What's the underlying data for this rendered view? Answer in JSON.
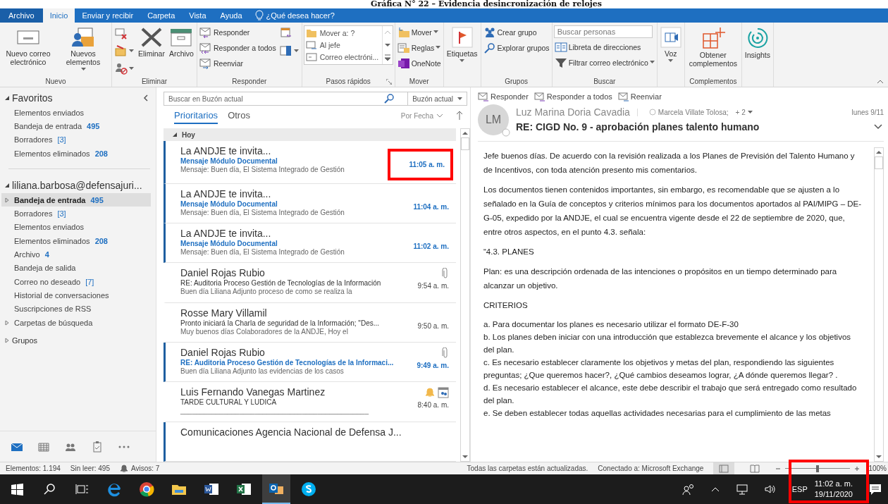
{
  "caption": "Gráfica N° 22 – Evidencia desincronización de relojes",
  "tabs": [
    {
      "label": "Archivo",
      "kind": "file",
      "selected": false
    },
    {
      "label": "Inicio",
      "kind": "tab",
      "selected": true
    },
    {
      "label": "Enviar y recibir",
      "kind": "tab",
      "selected": false
    },
    {
      "label": "Carpeta",
      "kind": "tab",
      "selected": false
    },
    {
      "label": "Vista",
      "kind": "tab",
      "selected": false
    },
    {
      "label": "Ayuda",
      "kind": "tab",
      "selected": false
    },
    {
      "label": "¿Qué desea hacer?",
      "kind": "tell",
      "selected": false
    }
  ],
  "ribbon": {
    "groups": [
      {
        "label": "Nuevo",
        "items": [
          {
            "kind": "large",
            "label": "Nuevo correo electrónico",
            "dropdown": false
          },
          {
            "kind": "large",
            "label": "Nuevos elementos",
            "dropdown": true
          }
        ]
      },
      {
        "label": "Eliminar",
        "items": [
          {
            "kind": "column",
            "items": [
              {
                "kind": "icon",
                "dropdown": false
              },
              {
                "kind": "icon",
                "dropdown": true
              },
              {
                "kind": "icon",
                "dropdown": true
              }
            ]
          },
          {
            "kind": "large",
            "label": "Eliminar",
            "dropdown": false
          },
          {
            "kind": "large",
            "label": "Archivo",
            "dropdown": false
          }
        ]
      },
      {
        "label": "Responder",
        "items": [
          {
            "kind": "column",
            "items": [
              {
                "kind": "small",
                "label": "Responder",
                "dropdown": false
              },
              {
                "kind": "small",
                "label": "Responder a todos",
                "dropdown": false
              },
              {
                "kind": "small",
                "label": "Reenviar",
                "dropdown": false
              }
            ]
          },
          {
            "kind": "column",
            "items": [
              {
                "kind": "icon",
                "dropdown": false
              },
              {
                "kind": "icon",
                "dropdown": true
              }
            ]
          }
        ]
      },
      {
        "label": "Pasos rápidos",
        "launcher": true,
        "items": [
          {
            "kind": "quicksteps",
            "items": [
              "Mover a: ?",
              "Al jefe",
              "Correo electróni..."
            ]
          }
        ]
      },
      {
        "label": "Mover",
        "items": [
          {
            "kind": "column",
            "items": [
              {
                "kind": "small",
                "label": "Mover",
                "dropdown": true
              },
              {
                "kind": "small",
                "label": "Reglas",
                "dropdown": true
              },
              {
                "kind": "small",
                "label": "OneNote",
                "dropdown": false
              }
            ]
          }
        ]
      },
      {
        "items": [
          {
            "kind": "large",
            "label": "Etiquetas",
            "dropdown": true
          }
        ]
      },
      {
        "label": "Grupos",
        "items": [
          {
            "kind": "column",
            "items": [
              {
                "kind": "small",
                "label": "Crear grupo",
                "dropdown": false
              },
              {
                "kind": "small",
                "label": "Explorar grupos",
                "dropdown": false
              }
            ]
          }
        ]
      },
      {
        "label": "Buscar",
        "items": [
          {
            "kind": "column",
            "items": [
              {
                "kind": "field",
                "placeholder": "Buscar personas"
              },
              {
                "kind": "small",
                "label": "Libreta de direcciones",
                "dropdown": false
              },
              {
                "kind": "small",
                "label": "Filtrar correo electrónico",
                "dropdown": true
              }
            ]
          }
        ]
      },
      {
        "items": [
          {
            "kind": "large",
            "label": "Voz",
            "dropdown": true
          }
        ]
      },
      {
        "label": "Complementos",
        "items": [
          {
            "kind": "large",
            "label": "Obtener complementos",
            "dropdown": false
          }
        ]
      },
      {
        "items": [
          {
            "kind": "large",
            "label": "Insights",
            "dropdown": false
          }
        ]
      }
    ]
  },
  "folders": {
    "sections": [
      {
        "label": "Favoritos",
        "kind": "favorites",
        "expanded": true,
        "items": [
          {
            "label": "Elementos enviados",
            "selected": false
          },
          {
            "label": "Bandeja de entrada",
            "count": "495",
            "count_bold": true,
            "selected": false
          },
          {
            "label": "Borradores",
            "count": "[3]",
            "count_bold": false,
            "selected": false
          },
          {
            "label": "Elementos eliminados",
            "count": "208",
            "count_bold": true,
            "selected": false
          }
        ]
      },
      {
        "label": "liliana.barbosa@defensajuri...",
        "kind": "account",
        "expanded": true,
        "items": [
          {
            "label": "Bandeja de entrada",
            "count": "495",
            "count_bold": true,
            "selected": true,
            "expanded": false
          },
          {
            "label": "Borradores",
            "count": "[3]",
            "count_bold": false,
            "selected": false
          },
          {
            "label": "Elementos enviados",
            "selected": false
          },
          {
            "label": "Elementos eliminados",
            "count": "208",
            "count_bold": true,
            "selected": false
          },
          {
            "label": "Archivo",
            "count": "4",
            "count_bold": true,
            "selected": false
          },
          {
            "label": "Bandeja de salida",
            "selected": false
          },
          {
            "label": "Correo no deseado",
            "count": "[7]",
            "count_bold": false,
            "selected": false
          },
          {
            "label": "Historial de conversaciones",
            "selected": false
          },
          {
            "label": "Suscripciones de RSS",
            "selected": false
          },
          {
            "label": "Carpetas de búsqueda",
            "selected": false,
            "expanded": false
          }
        ]
      },
      {
        "label": "Grupos",
        "kind": "groups",
        "expanded": false
      }
    ],
    "nav": [
      {
        "selected": true
      },
      {
        "selected": false
      },
      {
        "selected": false
      },
      {
        "selected": false
      },
      {
        "selected": false
      }
    ]
  },
  "mail_list": {
    "search": {
      "placeholder": "Buscar en Buzón actual",
      "scope": "Buzón actual"
    },
    "tabs": [
      {
        "label": "Prioritarios",
        "selected": true
      },
      {
        "label": "Otros",
        "selected": false
      }
    ],
    "sort": "Por Fecha",
    "group": {
      "label": "Hoy",
      "expanded": true
    },
    "messages": [
      {
        "sender": "La ANDJE te invita...",
        "subject": "Mensaje Módulo Documental",
        "preview": "Mensaje:  Buen día,  El Sistema Integrado de Gestión",
        "time": "11:05 a. m.",
        "unread": true,
        "attachment": false,
        "reminder": false,
        "highlighted": true
      },
      {
        "sender": "La ANDJE te invita...",
        "subject": "Mensaje Módulo Documental",
        "preview": "Mensaje:  Buen día,  El Sistema Integrado de Gestión",
        "time": "11:04 a. m.",
        "unread": true,
        "attachment": false,
        "reminder": false,
        "highlighted": false
      },
      {
        "sender": "La ANDJE te invita...",
        "subject": "Mensaje Módulo Documental",
        "preview": "Mensaje:  Buen día,  El Sistema Integrado de Gestión",
        "time": "11:02 a. m.",
        "unread": true,
        "attachment": false,
        "reminder": false,
        "highlighted": false
      },
      {
        "sender": "Daniel Rojas Rubio",
        "subject": "RE: Auditoria Proceso Gestión de Tecnologías de la Información",
        "preview": "Buen día Liliana  Adjunto proceso de como se realiza la",
        "time": "9:54 a. m.",
        "unread": false,
        "attachment": true,
        "reminder": false,
        "highlighted": false
      },
      {
        "sender": "Rosse Mary Villamil",
        "subject": "Pronto iniciará la Charla de seguridad de la Información; \"Des...",
        "preview": "Muy buenos días Colaboradores de la ANDJE,  Hoy  el",
        "time": "9:50 a. m.",
        "unread": false,
        "attachment": false,
        "reminder": false,
        "highlighted": false
      },
      {
        "sender": "Daniel Rojas Rubio",
        "subject": "RE: Auditoria Proceso Gestión de Tecnologías de la Informaci...",
        "preview": "Buen día Liliana  Adjunto las evidencias de los casos",
        "time": "9:49 a. m.",
        "unread": true,
        "attachment": true,
        "reminder": false,
        "highlighted": false
      },
      {
        "sender": "Luis Fernando Vanegas Martinez",
        "subject": "TARDE CULTURAL Y LUDICA",
        "preview": "________________________________________________",
        "time": "8:40 a. m.",
        "unread": false,
        "attachment": false,
        "reminder": true,
        "highlighted": false
      },
      {
        "sender": "Comunicaciones Agencia Nacional de Defensa J...",
        "unread": true,
        "attachment": false,
        "reminder": false,
        "highlighted": false
      }
    ]
  },
  "reading": {
    "actions": [
      "Responder",
      "Responder a todos",
      "Reenviar"
    ],
    "initials": "LM",
    "sender": "Luz Marina Doria Cavadia",
    "to": "Marcela Villate Tolosa;",
    "more": "+ 2",
    "date": "lunes 9/11",
    "subject": "RE: CIGD No. 9 -  aprobación planes talento humano",
    "body": [
      {
        "kind": "paragraph",
        "text": "Jefe buenos días. De acuerdo con la revisión realizada a los Planes de Previsión del Talento Humano y de Incentivos, con toda atención presento mis comentarios."
      },
      {
        "kind": "paragraph",
        "text": "Los documentos tienen contenidos importantes, sin embargo, es recomendable que se ajusten a lo señalado en la Guía de conceptos y criterios mínimos para los documentos aportados al PAI/MIPG – DE-G-05, expedido por la ANDJE, el cual se encuentra vigente desde el 22 de septiembre de 2020, que, entre otros aspectos, en el punto 4.3. señala:"
      },
      {
        "kind": "paragraph",
        "text": "“4.3. PLANES"
      },
      {
        "kind": "paragraph",
        "text": "Plan: es una descripción ordenada de las intenciones o propósitos en un tiempo determinado para alcanzar un objetivo."
      },
      {
        "kind": "paragraph",
        "text": "CRITERIOS"
      },
      {
        "kind": "lines",
        "lines": [
          "a. Para documentar los planes es necesario utilizar el formato DE-F-30",
          "b. Los planes deben iniciar con una introducción que establezca brevemente el alcance y los objetivos del plan.",
          "c. Es necesario establecer claramente los objetivos y metas del plan, respondiendo las siguientes preguntas; ¿Que queremos hacer?, ¿Qué cambios deseamos lograr, ¿A dónde queremos llegar? .",
          "d. Es necesario establecer el alcance, este debe describir el trabajo que será entregado como resultado del plan.",
          "e. Se deben establecer todas aquellas actividades necesarias para el cumplimiento de las metas"
        ]
      }
    ]
  },
  "status_bar": {
    "items": "Elementos: 1.194",
    "unread": "Sin leer: 495",
    "reminders": "Avisos: 7",
    "sync": "Todas las carpetas están actualizadas.",
    "connection": "Conectado a: Microsoft Exchange",
    "zoom": {
      "level": 0.5,
      "reading": "100%"
    }
  },
  "taskbar": {
    "apps": [
      {
        "selected": false
      },
      {
        "selected": false
      },
      {
        "selected": false
      },
      {
        "selected": false
      },
      {
        "selected": false
      },
      {
        "selected": false
      },
      {
        "selected": true
      },
      {
        "selected": false
      }
    ],
    "language": "ESP",
    "time": "11:02 a. m.",
    "date": "19/11/2020",
    "highlighted": true
  }
}
